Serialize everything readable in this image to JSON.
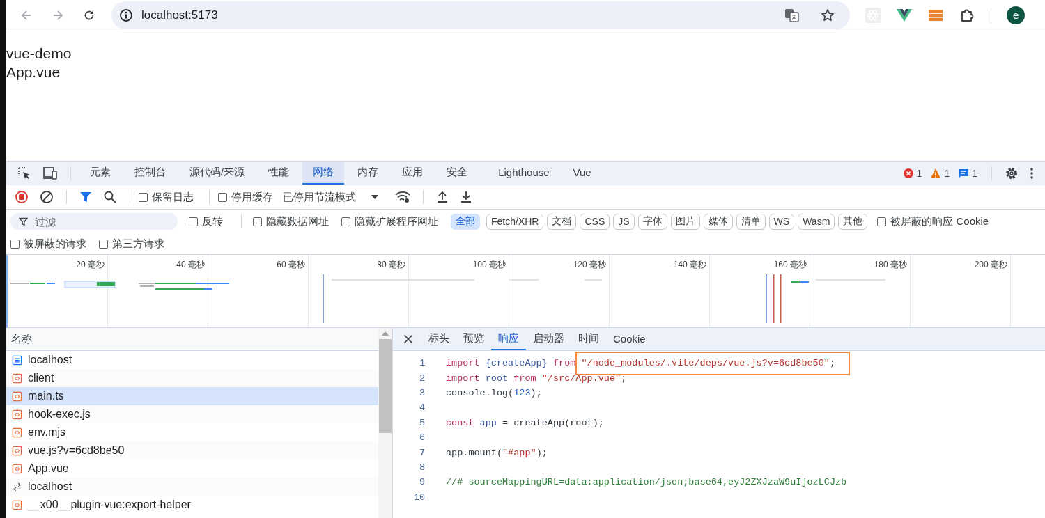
{
  "browser": {
    "address": "localhost:5173",
    "avatar": "e"
  },
  "page": {
    "lines": [
      "vue-demo",
      "App.vue"
    ]
  },
  "devtools": {
    "tabs": [
      {
        "label": "元素",
        "selected": false
      },
      {
        "label": "控制台",
        "selected": false
      },
      {
        "label": "源代码/来源",
        "selected": false
      },
      {
        "label": "性能",
        "selected": false
      },
      {
        "label": "网络",
        "selected": true
      },
      {
        "label": "内存",
        "selected": false
      },
      {
        "label": "应用",
        "selected": false
      },
      {
        "label": "安全",
        "selected": false
      },
      {
        "label": "Lighthouse",
        "selected": false
      },
      {
        "label": "Vue",
        "selected": false
      }
    ],
    "counts": {
      "errors": "1",
      "warnings": "1",
      "messages": "1"
    },
    "toolbar": {
      "preserve_log": {
        "label": "保留日志",
        "checked": false
      },
      "disable_cache": {
        "label": "停用缓存",
        "checked": false
      },
      "throttle": "已停用节流模式"
    },
    "filter": {
      "placeholder": "过滤",
      "invert": {
        "label": "反转",
        "checked": false
      },
      "options": [
        {
          "label": "隐藏数据网址",
          "checked": false
        },
        {
          "label": "隐藏扩展程序网址",
          "checked": false
        }
      ],
      "types": [
        {
          "label": "全部",
          "selected": true
        },
        {
          "label": "Fetch/XHR",
          "selected": false
        },
        {
          "label": "文档",
          "selected": false
        },
        {
          "label": "CSS",
          "selected": false
        },
        {
          "label": "JS",
          "selected": false
        },
        {
          "label": "字体",
          "selected": false
        },
        {
          "label": "图片",
          "selected": false
        },
        {
          "label": "媒体",
          "selected": false
        },
        {
          "label": "清单",
          "selected": false
        },
        {
          "label": "WS",
          "selected": false
        },
        {
          "label": "Wasm",
          "selected": false
        },
        {
          "label": "其他",
          "selected": false
        }
      ],
      "blocked_cookies": {
        "label": "被屏蔽的响应 Cookie",
        "checked": false
      },
      "more": [
        {
          "label": "被屏蔽的请求",
          "checked": false
        },
        {
          "label": "第三方请求",
          "checked": false
        }
      ]
    },
    "timeline_ticks": [
      "20 毫秒",
      "40 毫秒",
      "60 毫秒",
      "80 毫秒",
      "100 毫秒",
      "120 毫秒",
      "140 毫秒",
      "160 毫秒",
      "180 毫秒",
      "200 毫秒"
    ],
    "requests": {
      "header": "名称",
      "rows": [
        {
          "name": "localhost",
          "kind": "document",
          "selected": false
        },
        {
          "name": "client",
          "kind": "script",
          "selected": false
        },
        {
          "name": "main.ts",
          "kind": "script",
          "selected": true
        },
        {
          "name": "hook-exec.js",
          "kind": "script",
          "selected": false
        },
        {
          "name": "env.mjs",
          "kind": "script",
          "selected": false
        },
        {
          "name": "vue.js?v=6cd8be50",
          "kind": "script",
          "selected": false
        },
        {
          "name": "App.vue",
          "kind": "script",
          "selected": false
        },
        {
          "name": "localhost",
          "kind": "websocket",
          "selected": false
        },
        {
          "name": "__x00__plugin-vue:export-helper",
          "kind": "script",
          "selected": false
        }
      ]
    },
    "detail": {
      "tabs": [
        {
          "label": "标头",
          "selected": false
        },
        {
          "label": "预览",
          "selected": false
        },
        {
          "label": "响应",
          "selected": true
        },
        {
          "label": "启动器",
          "selected": false
        },
        {
          "label": "时间",
          "selected": false
        },
        {
          "label": "Cookie",
          "selected": false
        }
      ],
      "code": [
        {
          "number": "1",
          "tokens": [
            {
              "text": "import",
              "kind": "keyword"
            },
            {
              "text": " {createApp}",
              "kind": "variable"
            },
            {
              "text": " from",
              "kind": "keyword"
            },
            {
              "text": " \"/node_modules/.vite/deps/vue.js?v=6cd8be50\"",
              "kind": "string"
            },
            {
              "text": ";",
              "kind": "plain"
            }
          ]
        },
        {
          "number": "2",
          "tokens": [
            {
              "text": "import",
              "kind": "keyword"
            },
            {
              "text": " root",
              "kind": "variable"
            },
            {
              "text": " from",
              "kind": "keyword"
            },
            {
              "text": " \"/src/App.vue\"",
              "kind": "string"
            },
            {
              "text": ";",
              "kind": "plain"
            }
          ]
        },
        {
          "number": "3",
          "tokens": [
            {
              "text": "console.log(",
              "kind": "plain"
            },
            {
              "text": "123",
              "kind": "number"
            },
            {
              "text": ");",
              "kind": "plain"
            }
          ]
        },
        {
          "number": "4"
        },
        {
          "number": "5",
          "tokens": [
            {
              "text": "const",
              "kind": "keyword"
            },
            {
              "text": " app",
              "kind": "variable"
            },
            {
              "text": " = createApp(root);",
              "kind": "plain"
            }
          ]
        },
        {
          "number": "6"
        },
        {
          "number": "7",
          "tokens": [
            {
              "text": "app.mount(",
              "kind": "plain"
            },
            {
              "text": "\"#app\"",
              "kind": "string"
            },
            {
              "text": ");",
              "kind": "plain"
            }
          ]
        },
        {
          "number": "8"
        },
        {
          "number": "9",
          "tokens": [
            {
              "text": "//# sourceMappingURL=data:application/json;base64,eyJ2ZXJzaW9uIjozLCJzb",
              "kind": "comment"
            }
          ]
        },
        {
          "number": "10"
        }
      ]
    }
  }
}
